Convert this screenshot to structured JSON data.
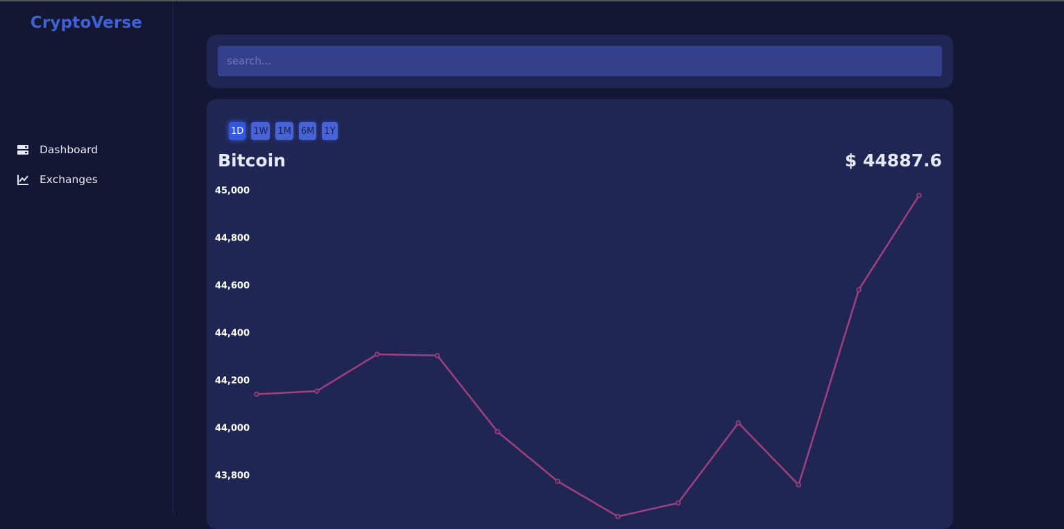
{
  "app": {
    "brand": "CryptoVerse"
  },
  "sidebar": {
    "items": [
      {
        "label": "Dashboard",
        "icon": "dashboard-icon"
      },
      {
        "label": "Exchanges",
        "icon": "line-chart-icon"
      }
    ]
  },
  "search": {
    "placeholder": "search..."
  },
  "chart_panel": {
    "periods": [
      "1D",
      "1W",
      "1M",
      "6M",
      "1Y"
    ],
    "active_period": "1D",
    "coin_name": "Bitcoin",
    "price": "$ 44887.6"
  },
  "colors": {
    "background": "#131733",
    "card": "#202654",
    "accent": "#3d63d6",
    "line": "#a2407f"
  },
  "chart_data": {
    "type": "line",
    "title": "",
    "xlabel": "",
    "ylabel": "",
    "x": [
      1,
      2,
      3,
      4,
      5,
      6,
      7,
      8,
      9,
      10,
      11,
      12
    ],
    "series": [
      {
        "values": [
          44140,
          44153,
          44308,
          44303,
          43982,
          43773,
          43625,
          43682,
          44019,
          43758,
          44580,
          44977
        ]
      }
    ],
    "y_ticks": [
      "45,000",
      "44,800",
      "44,600",
      "44,400",
      "44,200",
      "44,000",
      "43,800"
    ],
    "ylim": [
      43600,
      45000
    ],
    "grid": false,
    "legend": "none"
  }
}
